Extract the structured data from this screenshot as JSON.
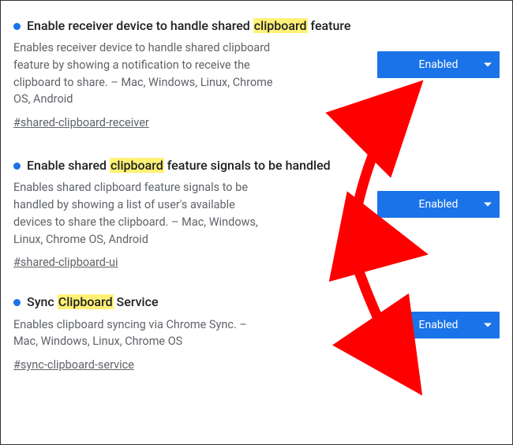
{
  "flags": [
    {
      "title_pre": "Enable receiver device to handle shared ",
      "title_hl": "clipboard",
      "title_post": " feature",
      "description": "Enables receiver device to handle shared clipboard feature by showing a notification to receive the clipboard to share. – Mac, Windows, Linux, Chrome OS, Android",
      "anchor": "#shared-clipboard-receiver",
      "value": "Enabled"
    },
    {
      "title_pre": "Enable shared ",
      "title_hl": "clipboard",
      "title_post": " feature signals to be handled",
      "description": "Enables shared clipboard feature signals to be handled by showing a list of user's available devices to share the clipboard. – Mac, Windows, Linux, Chrome OS, Android",
      "anchor": "#shared-clipboard-ui",
      "value": "Enabled"
    },
    {
      "title_pre": "Sync ",
      "title_hl": "Clipboard",
      "title_post": " Service",
      "description": "Enables clipboard syncing via Chrome Sync. – Mac, Windows, Linux, Chrome OS",
      "anchor": "#sync-clipboard-service",
      "value": "Enabled"
    }
  ],
  "colors": {
    "accent": "#1a73e8",
    "highlight": "#fff176",
    "annotation": "#ff0000"
  }
}
